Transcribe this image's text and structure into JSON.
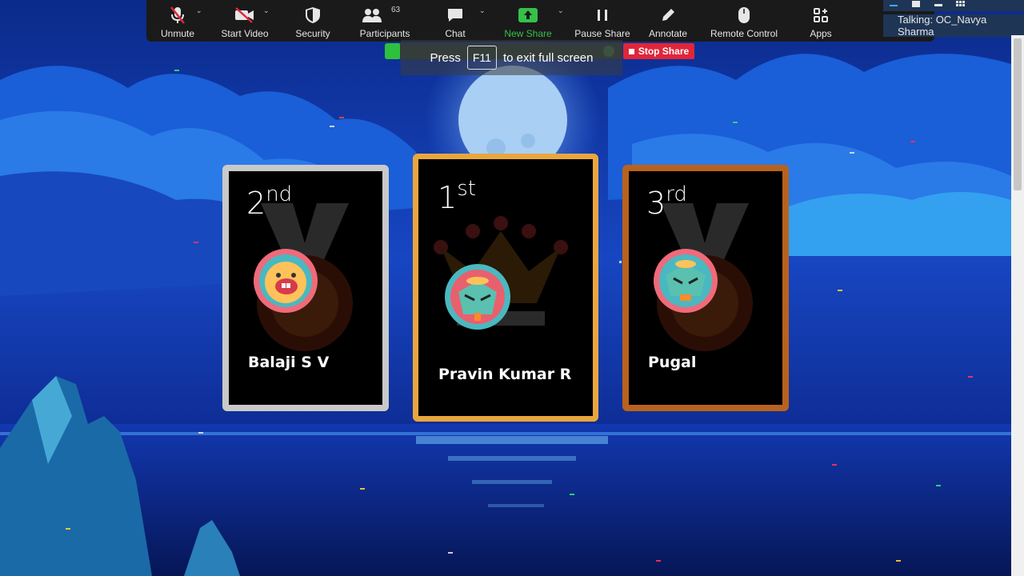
{
  "toolbar": {
    "unmute": "Unmute",
    "start_video": "Start Video",
    "security": "Security",
    "participants": "Participants",
    "participants_count": "63",
    "chat": "Chat",
    "new_share": "New Share",
    "pause_share": "Pause Share",
    "annotate": "Annotate",
    "remote_control": "Remote Control",
    "apps": "Apps"
  },
  "fullscreen_hint": {
    "press": "Press",
    "key": "F11",
    "rest": "to exit full screen"
  },
  "stop_share": "Stop Share",
  "talking": "Talking: OC_Navya Sharma",
  "leaderboard": {
    "first": {
      "rank_num": "1",
      "rank_suffix": "st",
      "name": "Pravin Kumar R"
    },
    "second": {
      "rank_num": "2",
      "rank_suffix": "nd",
      "name": "Balaji S V"
    },
    "third": {
      "rank_num": "3",
      "rank_suffix": "rd",
      "name": "Pugal"
    }
  },
  "colors": {
    "gold": "#e9a63d",
    "silver": "#c9c9c9",
    "bronze": "#b8621e",
    "zoom_green": "#35c04a",
    "stop_red": "#e0263a"
  }
}
